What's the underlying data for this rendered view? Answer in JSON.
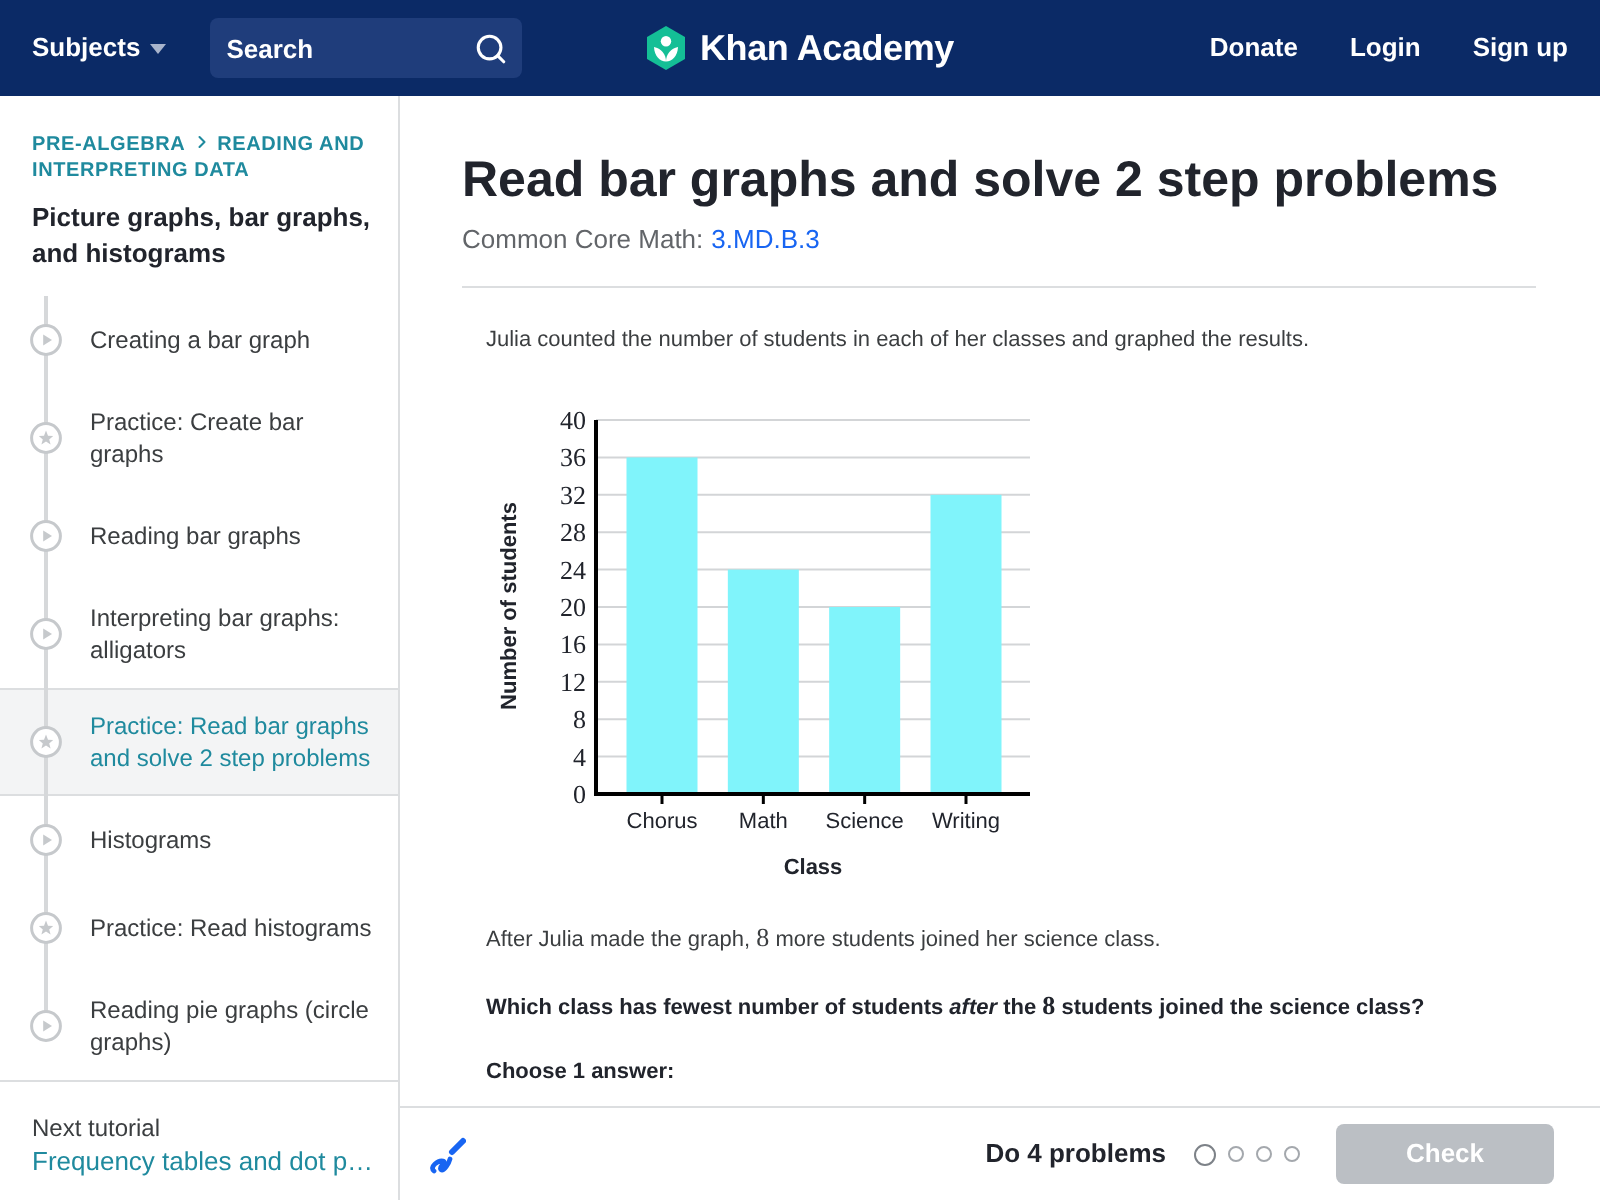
{
  "header": {
    "subjects_menu": "Subjects",
    "search": {
      "placeholder": "Search"
    },
    "logo_text": "Khan Academy",
    "nav_links": [
      "Donate",
      "Login",
      "Sign up"
    ]
  },
  "sidebar": {
    "breadcrumb": [
      "PRE-ALGEBRA",
      "READING AND INTERPRETING DATA"
    ],
    "title": "Picture graphs, bar graphs, and histograms",
    "items": [
      {
        "label": "Creating a bar graph",
        "kind": "video",
        "selected": false
      },
      {
        "label": "Practice: Create bar graphs",
        "kind": "exercise",
        "selected": false
      },
      {
        "label": "Reading bar graphs",
        "kind": "video",
        "selected": false
      },
      {
        "label": "Interpreting bar graphs: alligators",
        "kind": "video",
        "selected": false
      },
      {
        "label": "Practice: Read bar graphs and solve 2 step problems",
        "kind": "exercise",
        "selected": true
      },
      {
        "label": "Histograms",
        "kind": "video",
        "selected": false
      },
      {
        "label": "Practice: Read histograms",
        "kind": "exercise",
        "selected": false
      },
      {
        "label": "Reading pie graphs (circle graphs)",
        "kind": "video",
        "selected": false
      }
    ],
    "next_tutorial": {
      "label": "Next tutorial",
      "link": "Frequency tables and dot p…"
    }
  },
  "main": {
    "title": "Read bar graphs and solve 2 step problems",
    "standard": {
      "label": "Common Core Math:",
      "code": "3.MD.B.3"
    },
    "question": {
      "intro": "Julia counted the number of students in each of her classes and graphed the results.",
      "chart_data": {
        "type": "bar",
        "xlabel": "Class",
        "ylabel": "Number of students",
        "categories": [
          "Chorus",
          "Math",
          "Science",
          "Writing"
        ],
        "values": [
          36,
          24,
          20,
          32
        ],
        "ylim": [
          0,
          40
        ],
        "yticks": [
          0,
          4,
          8,
          12,
          16,
          20,
          24,
          28,
          32,
          36,
          40
        ],
        "grid": true
      },
      "follow_up": [
        {
          "kind": "text",
          "text": "After Julia made the graph,"
        },
        {
          "kind": "math",
          "text": "8"
        },
        {
          "kind": "text",
          "text": "more students joined her science class."
        }
      ],
      "prompt": [
        {
          "kind": "text",
          "text": "Which class has fewest number of students *after* the"
        },
        {
          "kind": "math",
          "text": "8"
        },
        {
          "kind": "text",
          "text": "students joined the science class?"
        }
      ],
      "instruction": "Choose 1 answer:"
    }
  },
  "footer": {
    "goal": "Do 4 problems",
    "progress_dots": [
      {
        "current": true
      },
      {
        "current": false
      },
      {
        "current": false
      },
      {
        "current": false
      }
    ],
    "check_button": {
      "label": "Check",
      "disabled": true
    }
  }
}
